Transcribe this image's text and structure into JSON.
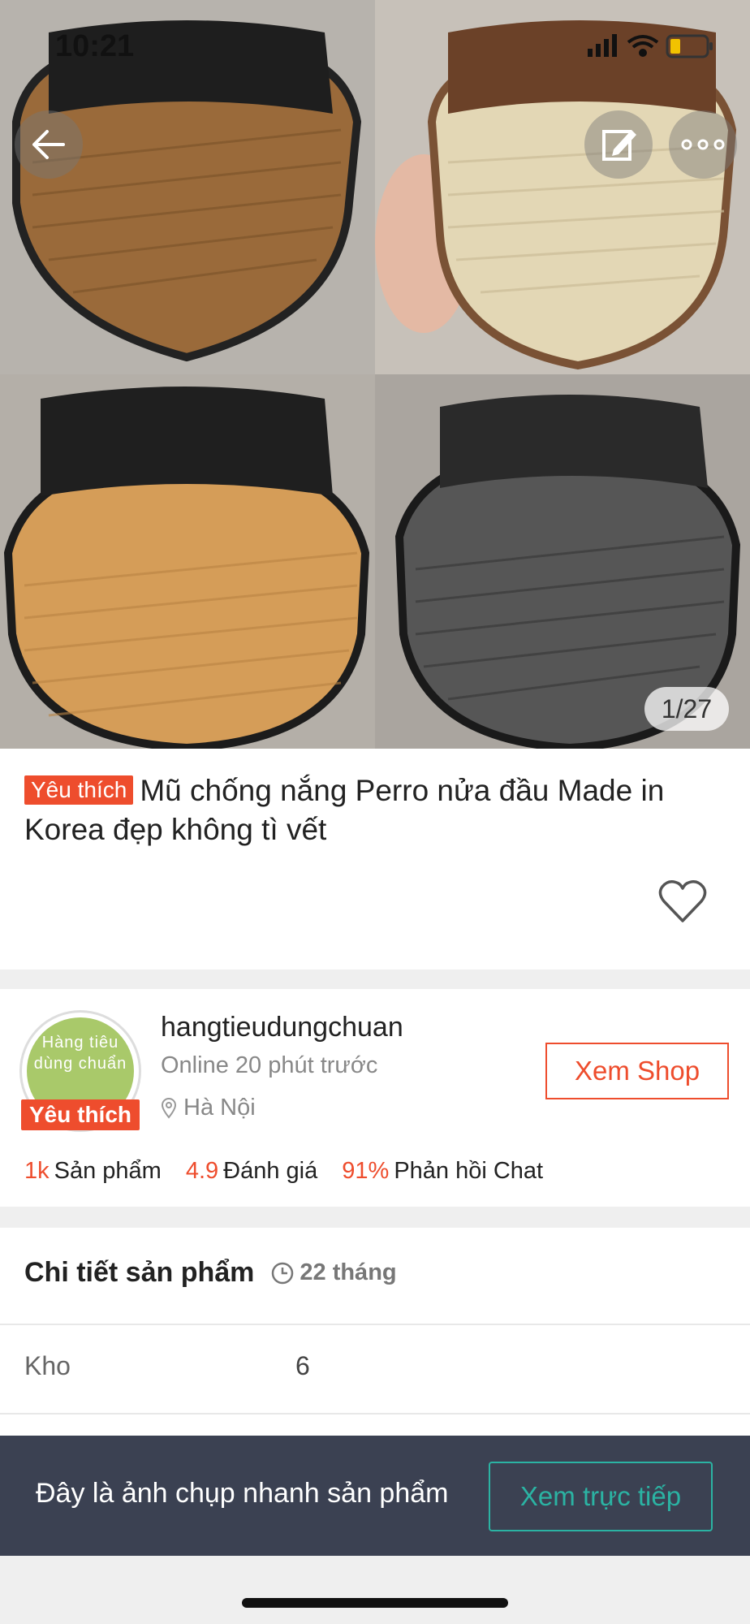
{
  "status_bar": {
    "time": "10:21"
  },
  "hero": {
    "counter": "1/27"
  },
  "product": {
    "badge": "Yêu thích",
    "title": "Mũ chống nắng Perro nửa đầu Made in Korea đẹp không tì vết"
  },
  "shop": {
    "avatar_text": "Hàng tiêu dùng chuẩn",
    "badge": "Yêu thích",
    "name": "hangtieudungchuan",
    "online": "Online 20 phút trước",
    "location": "Hà Nội",
    "view_shop_label": "Xem Shop",
    "stats": [
      {
        "value": "1k",
        "label": "Sản phẩm"
      },
      {
        "value": "4.9",
        "label": "Đánh giá"
      },
      {
        "value": "91%",
        "label": "Phản hồi Chat"
      }
    ]
  },
  "details": {
    "heading": "Chi tiết sản phẩm",
    "age": "22 tháng",
    "rows": [
      {
        "label": "Kho",
        "value": "6"
      }
    ]
  },
  "snapshot_banner": {
    "text": "Đây là ảnh chụp nhanh sản phẩm",
    "button_label": "Xem trực tiếp"
  },
  "colors": {
    "accent": "#ee4d2d",
    "teal": "#2bb3a3",
    "banner_bg": "#3b4152"
  }
}
